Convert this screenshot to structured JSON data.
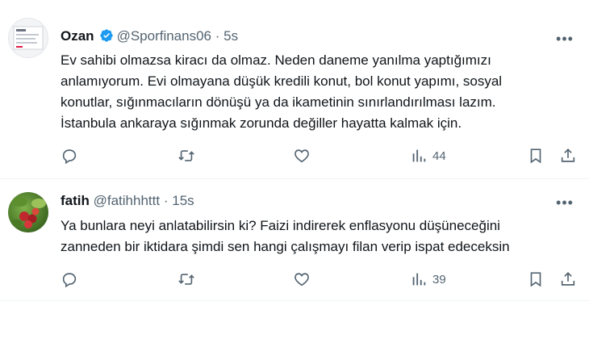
{
  "tweets": [
    {
      "name": "Ozan",
      "handle": "@Sporfinans06",
      "dot": "·",
      "time": "5s",
      "verified": true,
      "avatar_icon": "screenshot-avatar",
      "lines": [
        "Ev sahibi olmazsa kiracı da olmaz. Neden daneme yanılma yaptığımızı",
        "anlamıyorum. Evi olmayana düşük kredili konut, bol konut yapımı, sosyal",
        "konutlar, sığınmacıların dönüşü ya da ikametinin sınırlandırılması  lazım.",
        "İstanbula ankaraya sığınmak zorunda değiller hayatta kalmak için."
      ],
      "views": "44"
    },
    {
      "name": "fatih",
      "handle": "@fatihhhttt",
      "dot": "·",
      "time": "15s",
      "verified": false,
      "avatar_icon": "berries-avatar",
      "lines": [
        "Ya bunlara neyi anlatabilirsin ki? Faizi indirerek enflasyonu düşüneceğini",
        "zanneden bir iktidara şimdi sen hangi çalışmayı filan verip ispat edeceksin"
      ],
      "views": "39"
    }
  ],
  "colors": {
    "text": "#0f1419",
    "secondary": "#536471",
    "verified": "#1d9bf0",
    "divider": "#eff3f4"
  },
  "icons": [
    "reply-icon",
    "retweet-icon",
    "like-icon",
    "views-icon",
    "bookmark-icon",
    "share-icon",
    "more-icon",
    "verified-badge-icon"
  ]
}
